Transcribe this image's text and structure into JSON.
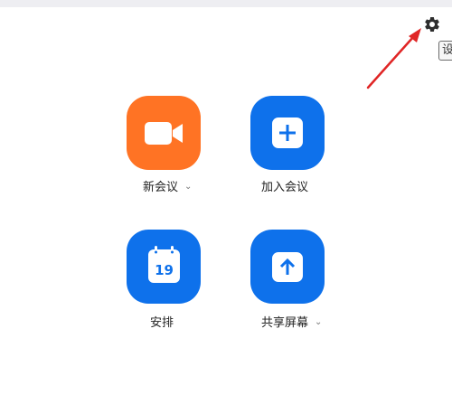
{
  "settings": {
    "icon": "gear-icon",
    "tooltip": "设置"
  },
  "home": {
    "new_meeting": {
      "label": "新会议",
      "icon": "video-camera-icon",
      "has_dropdown": true,
      "color": "#ff7324"
    },
    "join": {
      "label": "加入会议",
      "icon": "plus-icon",
      "color": "#0e71eb"
    },
    "schedule": {
      "label": "安排",
      "icon": "calendar-icon",
      "day": "19",
      "color": "#0e71eb"
    },
    "share_screen": {
      "label": "共享屏幕",
      "icon": "upload-arrow-icon",
      "has_dropdown": true,
      "color": "#0e71eb"
    }
  },
  "annotation": {
    "color": "#e02525"
  }
}
